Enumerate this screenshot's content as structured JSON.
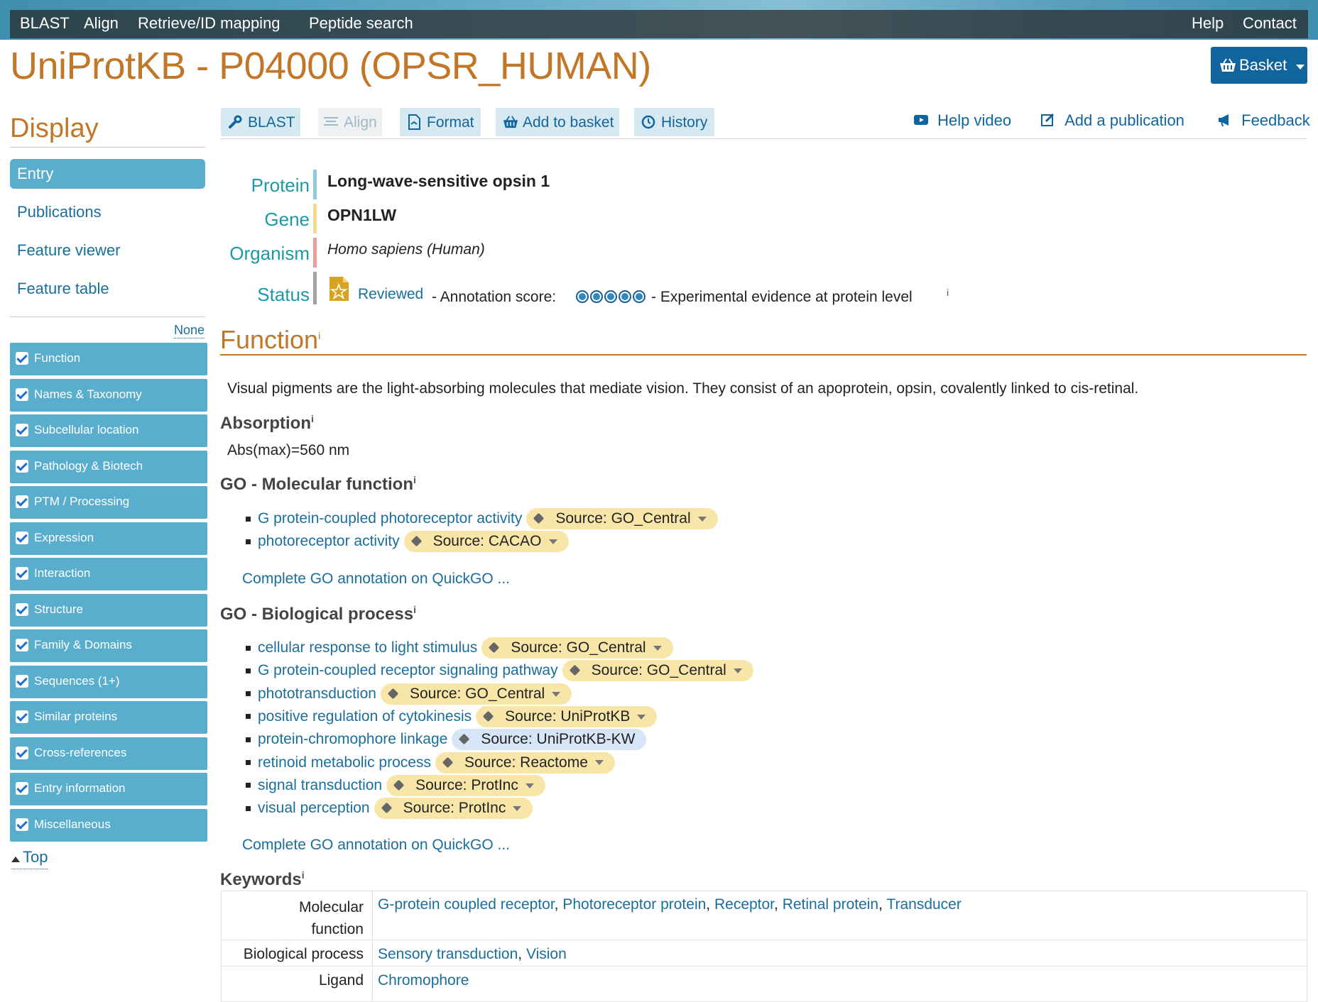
{
  "nav": {
    "left": [
      "BLAST",
      "Align",
      "Retrieve/ID mapping",
      "Peptide search"
    ],
    "right": [
      "Help",
      "Contact"
    ]
  },
  "title": "UniProtKB - P04000 (OPSR_HUMAN)",
  "basket_label": "Basket",
  "sidebar": {
    "heading": "Display",
    "entries": [
      "Entry",
      "Publications",
      "Feature viewer",
      "Feature table"
    ],
    "none_label": "None",
    "sections": [
      "Function",
      "Names & Taxonomy",
      "Subcellular location",
      "Pathology & Biotech",
      "PTM / Processing",
      "Expression",
      "Interaction",
      "Structure",
      "Family & Domains",
      "Sequences (1+)",
      "Similar proteins",
      "Cross-references",
      "Entry information",
      "Miscellaneous"
    ],
    "top_label": "Top"
  },
  "toolbar": {
    "blast": "BLAST",
    "align": "Align",
    "format": "Format",
    "add_to_basket": "Add to basket",
    "history": "History",
    "help_video": "Help video",
    "add_publication": "Add a publication",
    "feedback": "Feedback"
  },
  "entry": {
    "labels": {
      "protein": "Protein",
      "gene": "Gene",
      "organism": "Organism",
      "status": "Status"
    },
    "protein": "Long-wave-sensitive opsin 1",
    "gene": "OPN1LW",
    "organism": "Homo sapiens (Human)",
    "status": "Reviewed",
    "annotation_label": "- Annotation score:",
    "annotation_score": 5,
    "evidence": "- Experimental evidence at protein level"
  },
  "function": {
    "title": "Function",
    "description": "Visual pigments are the light-absorbing molecules that mediate vision. They consist of an apoprotein, opsin, covalently linked to cis-retinal.",
    "absorption_heading": "Absorption",
    "absorption_value": "Abs(max)=560 nm",
    "go_mf_heading": "GO - Molecular function",
    "go_mf": [
      {
        "term": "G protein-coupled photoreceptor activity",
        "source": "Source: GO_Central"
      },
      {
        "term": "photoreceptor activity",
        "source": "Source: CACAO"
      }
    ],
    "quickgo_label": "Complete GO annotation on QuickGO ...",
    "go_bp_heading": "GO - Biological process",
    "go_bp": [
      {
        "term": "cellular response to light stimulus",
        "source": "Source: GO_Central"
      },
      {
        "term": "G protein-coupled receptor signaling pathway",
        "source": "Source: GO_Central"
      },
      {
        "term": "phototransduction",
        "source": "Source: GO_Central"
      },
      {
        "term": "positive regulation of cytokinesis",
        "source": "Source: UniProtKB"
      },
      {
        "term": "protein-chromophore linkage",
        "source": "Source: UniProtKB-KW"
      },
      {
        "term": "retinoid metabolic process",
        "source": "Source: Reactome"
      },
      {
        "term": "signal transduction",
        "source": "Source: ProtInc"
      },
      {
        "term": "visual perception",
        "source": "Source: ProtInc"
      }
    ],
    "keywords_heading": "Keywords",
    "keywords": [
      {
        "label_line1": "Molecular",
        "label_line2": "function",
        "values": [
          "G-protein coupled receptor",
          "Photoreceptor protein",
          "Receptor",
          "Retinal protein",
          "Transducer"
        ]
      },
      {
        "label_line1": "Biological process",
        "values": [
          "Sensory transduction",
          "Vision"
        ]
      },
      {
        "label_line1": "Ligand",
        "values": [
          "Chromophore"
        ]
      }
    ]
  },
  "info_superscript": "i",
  "colors": {
    "accent": "#c27628",
    "link": "#1a6e9c",
    "sidebar": "#59aece",
    "label_teal": "#1b9aa6",
    "source_yellow": "#f7e6a8",
    "source_blue": "#d7e6f7",
    "basket": "#11659e"
  }
}
